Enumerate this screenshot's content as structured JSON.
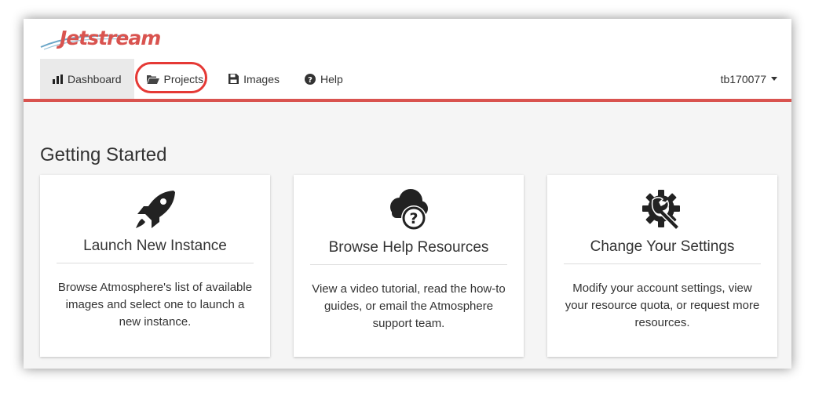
{
  "app": {
    "logo_text": "Jetstream",
    "brand_color": "#d9534f"
  },
  "nav": {
    "items": [
      {
        "label": "Dashboard",
        "icon": "bar-chart-icon",
        "active": true
      },
      {
        "label": "Projects",
        "icon": "folder-open-icon",
        "highlighted": true
      },
      {
        "label": "Images",
        "icon": "floppy-disk-icon"
      },
      {
        "label": "Help",
        "icon": "question-circle-icon"
      }
    ],
    "user": "tb170077"
  },
  "main": {
    "title": "Getting Started",
    "cards": [
      {
        "icon": "rocket-icon",
        "title": "Launch New Instance",
        "description": "Browse Atmosphere's list of available images and select one to launch a new instance."
      },
      {
        "icon": "cloud-question-icon",
        "title": "Browse Help Resources",
        "description": "View a video tutorial, read the how-to guides, or email the Atmosphere support team."
      },
      {
        "icon": "gear-wrench-icon",
        "title": "Change Your Settings",
        "description": "Modify your account settings, view your resource quota, or request more resources."
      }
    ]
  },
  "colors": {
    "accent": "#d9534f",
    "highlight_ring": "#e53935",
    "background": "#f5f5f5"
  }
}
